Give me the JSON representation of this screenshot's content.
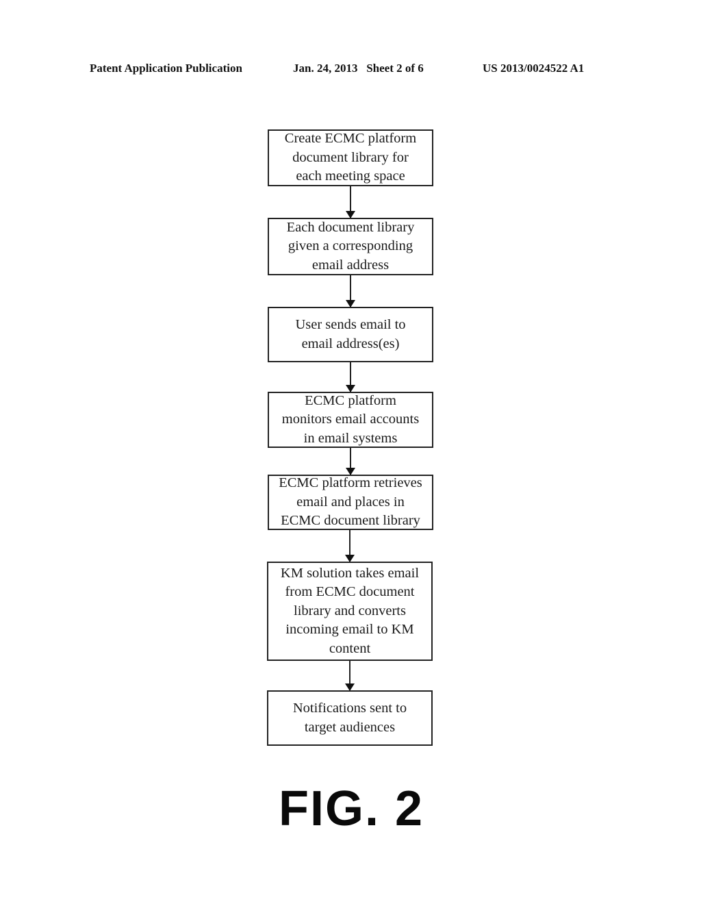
{
  "header": {
    "publication": "Patent Application Publication",
    "date_sheet": "Jan. 24, 2013   Sheet 2 of 6",
    "number": "US 2013/0024522 A1"
  },
  "flowchart": {
    "steps": [
      {
        "text": "Create ECMC platform\ndocument library for\neach meeting space"
      },
      {
        "text": "Each document library\ngiven a corresponding\nemail address"
      },
      {
        "text": "User sends email to\nemail address(es)"
      },
      {
        "text": "ECMC platform\nmonitors email accounts\nin email systems"
      },
      {
        "text": "ECMC platform retrieves\nemail and places in\nECMC document library"
      },
      {
        "text": "KM solution takes email\nfrom ECMC document\nlibrary and converts\nincoming email to KM\ncontent"
      },
      {
        "text": "Notifications sent to\ntarget audiences"
      }
    ]
  },
  "figure_label": "FIG. 2"
}
